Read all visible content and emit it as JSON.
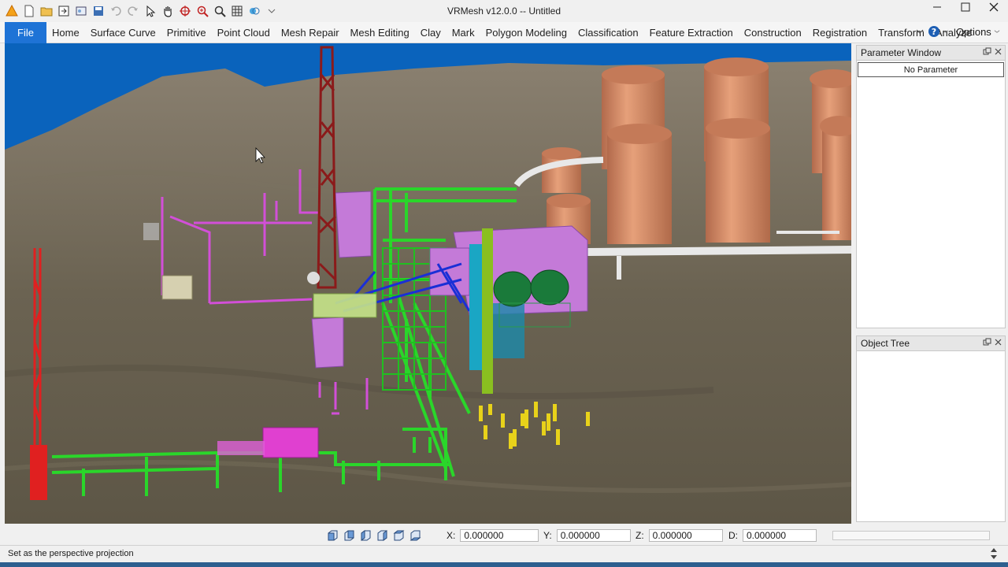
{
  "window": {
    "title": "VRMesh v12.0.0  -- Untitled"
  },
  "quick_access": [
    {
      "icon": "app-logo-icon"
    },
    {
      "icon": "new-file-icon"
    },
    {
      "icon": "open-folder-icon"
    },
    {
      "icon": "import-icon"
    },
    {
      "icon": "export-icon"
    },
    {
      "icon": "save-icon"
    },
    {
      "icon": "undo-icon"
    },
    {
      "icon": "redo-icon"
    },
    {
      "icon": "select-pointer-icon"
    },
    {
      "icon": "pan-hand-icon"
    },
    {
      "icon": "rotate-view-icon"
    },
    {
      "icon": "zoom-window-icon"
    },
    {
      "icon": "zoom-icon"
    },
    {
      "icon": "grid-icon"
    },
    {
      "icon": "render-mode-icon"
    },
    {
      "icon": "customize-dropdown-icon"
    }
  ],
  "menubar": {
    "file_label": "File",
    "tabs": [
      "Home",
      "Surface Curve",
      "Primitive",
      "Point Cloud",
      "Mesh Repair",
      "Mesh Editing",
      "Clay",
      "Mark",
      "Polygon Modeling",
      "Classification",
      "Feature Extraction",
      "Construction",
      "Registration",
      "Transform",
      "Analyze"
    ],
    "options_label": "Options"
  },
  "panels": {
    "parameter": {
      "title": "Parameter Window",
      "content": "No Parameter"
    },
    "object_tree": {
      "title": "Object Tree"
    }
  },
  "coordinates": {
    "x_label": "X:",
    "x_value": "0.000000",
    "y_label": "Y:",
    "y_value": "0.000000",
    "z_label": "Z:",
    "z_value": "0.000000",
    "d_label": "D:",
    "d_value": "0.000000"
  },
  "view_buttons": [
    "front-view-icon",
    "back-view-icon",
    "left-view-icon",
    "right-view-icon",
    "top-view-icon",
    "bottom-view-icon"
  ],
  "status": {
    "message": "Set as the perspective projection"
  },
  "colors": {
    "file_tab": "#1e73d6",
    "sky": "#0a63bc",
    "terrain": "#6b6352",
    "tanks": "#d48e6a",
    "pipes_green": "#2ad62a",
    "pipes_magenta": "#d24fd8",
    "derrick_red": "#8b1a1a",
    "stairs_blue": "#1a2fd6",
    "cyan": "#1aa6c4",
    "yellow": "#e8d21a"
  }
}
